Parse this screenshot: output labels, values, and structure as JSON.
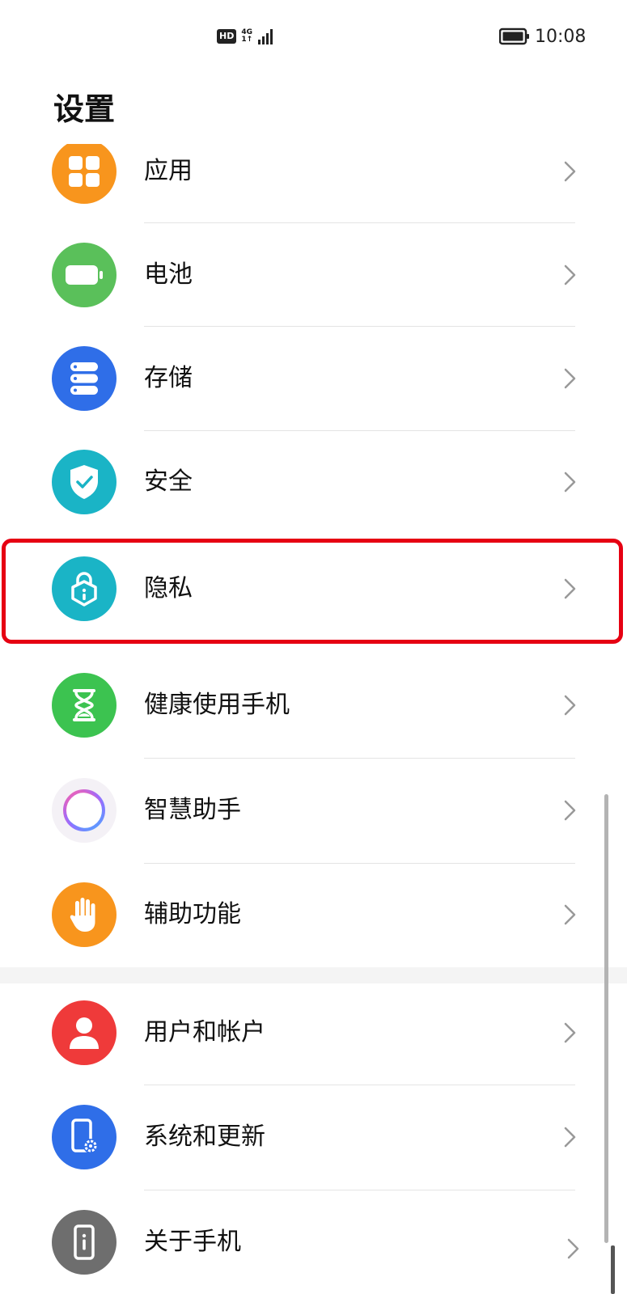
{
  "status_bar": {
    "hd_label": "HD",
    "network_label_top": "4G",
    "network_label_bottom": "1↑",
    "signal_icon": "signal-bars-icon",
    "battery_icon": "battery-icon",
    "time": "10:08"
  },
  "title": "设置",
  "items": [
    {
      "label": "应用",
      "icon": "apps-grid-icon",
      "color": "#f8951d"
    },
    {
      "label": "电池",
      "icon": "battery-icon",
      "color": "#5ac05a"
    },
    {
      "label": "存储",
      "icon": "storage-icon",
      "color": "#2f6ee8"
    },
    {
      "label": "安全",
      "icon": "shield-check-icon",
      "color": "#1ab4c6"
    },
    {
      "label": "隐私",
      "icon": "privacy-lock-icon",
      "color": "#1ab4c6"
    },
    {
      "label": "健康使用手机",
      "icon": "hourglass-icon",
      "color": "#3cc350"
    },
    {
      "label": "智慧助手",
      "icon": "assistant-ring-icon",
      "color": "#f4f1f6"
    },
    {
      "label": "辅助功能",
      "icon": "hand-icon",
      "color": "#f8951d"
    },
    {
      "label": "用户和帐户",
      "icon": "user-icon",
      "color": "#ef3a3a"
    },
    {
      "label": "系统和更新",
      "icon": "phone-gear-icon",
      "color": "#2f6ee8"
    },
    {
      "label": "关于手机",
      "icon": "phone-info-icon",
      "color": "#6e6e6e"
    }
  ],
  "highlighted_item": "隐私"
}
